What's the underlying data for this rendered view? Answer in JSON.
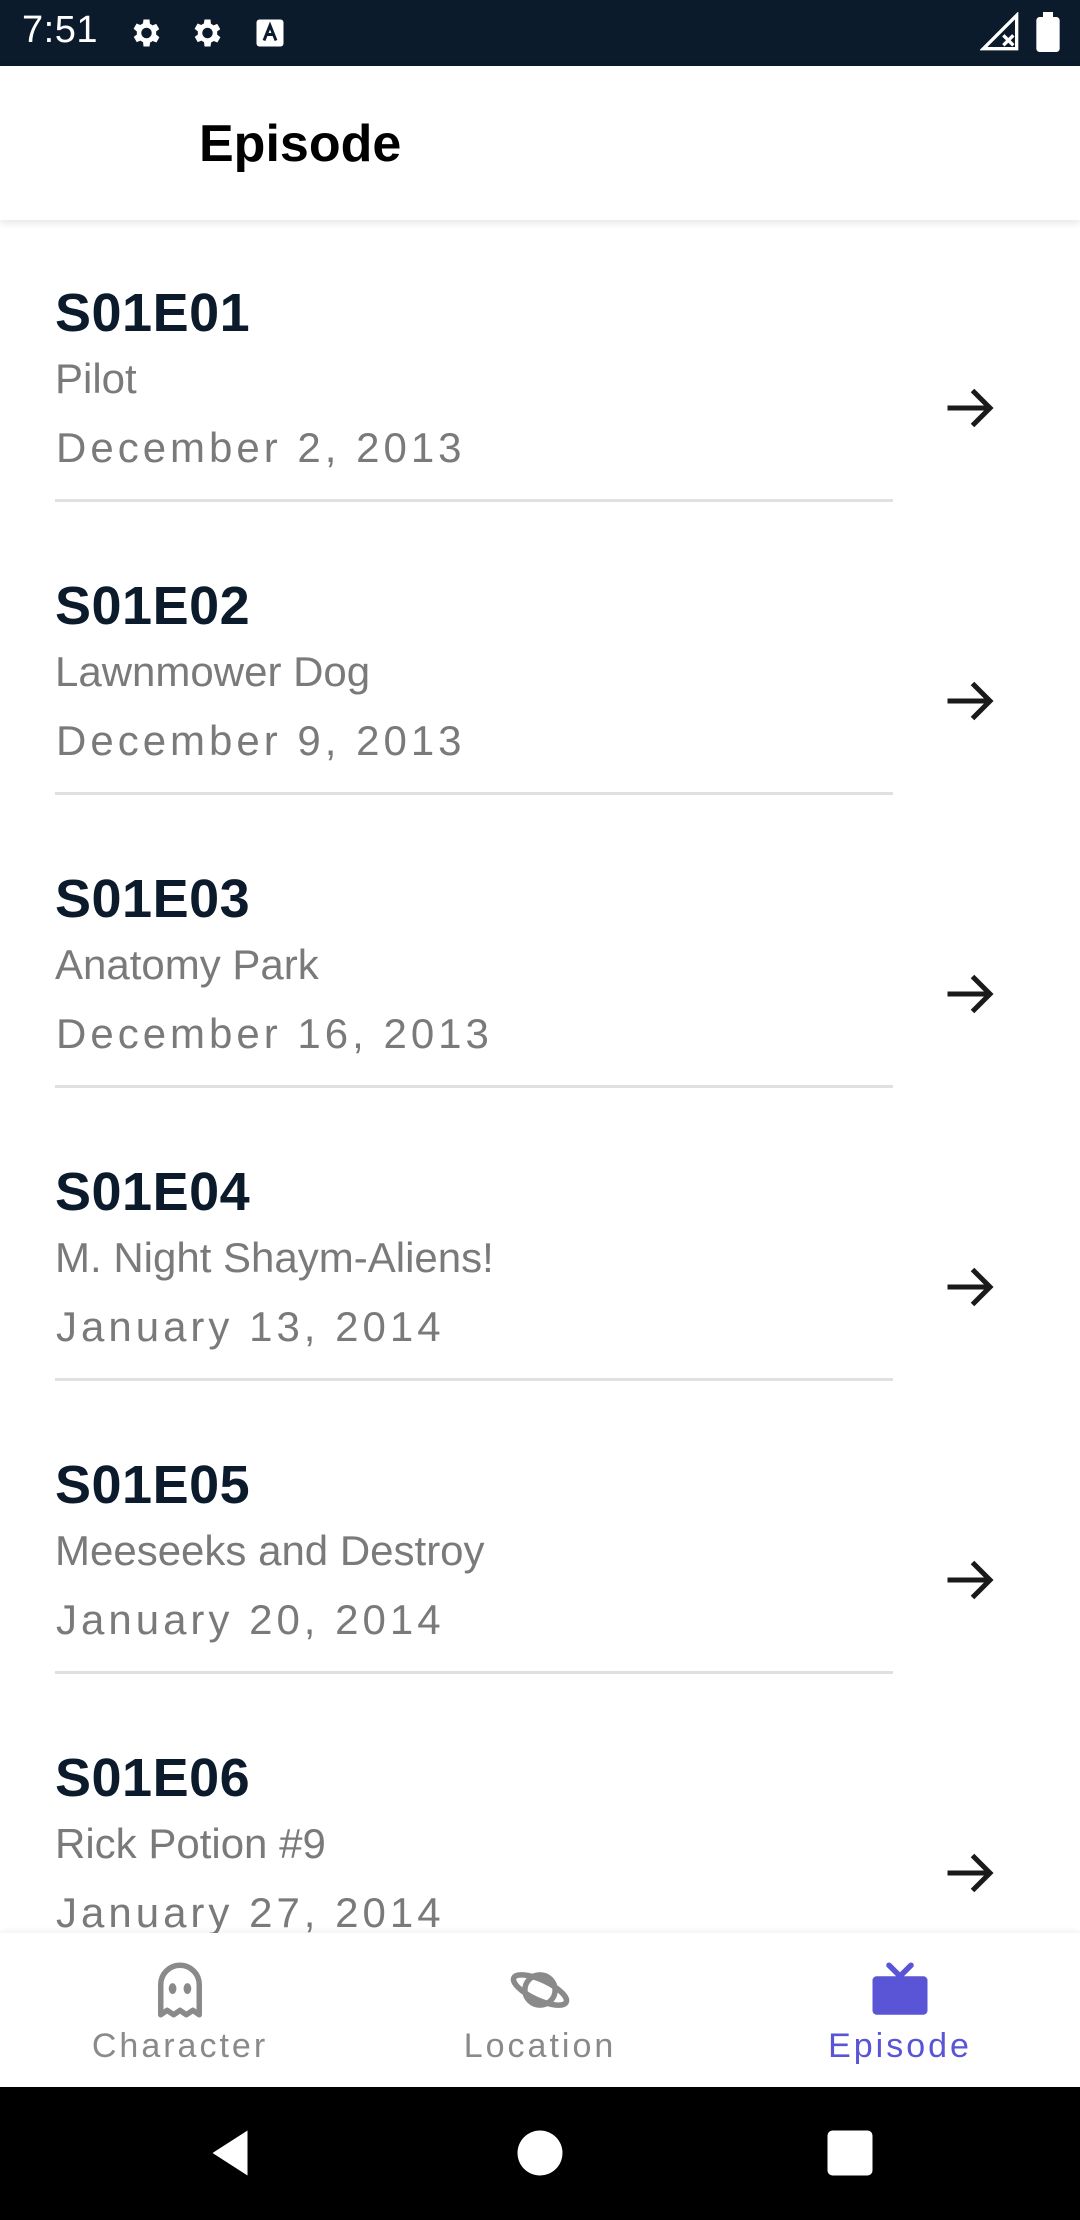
{
  "status_bar": {
    "time": "7:51",
    "icons": [
      "gear-icon",
      "gear-icon",
      "font-a-icon",
      "signal-icon",
      "battery-icon"
    ],
    "background": "#0b1b2c"
  },
  "app_bar": {
    "title": "Episode"
  },
  "episodes": [
    {
      "code": "S01E01",
      "name": "Pilot",
      "date": "December 2, 2013"
    },
    {
      "code": "S01E02",
      "name": "Lawnmower Dog",
      "date": "December 9, 2013"
    },
    {
      "code": "S01E03",
      "name": "Anatomy Park",
      "date": "December 16, 2013"
    },
    {
      "code": "S01E04",
      "name": "M. Night Shaym-Aliens!",
      "date": "January 13, 2014"
    },
    {
      "code": "S01E05",
      "name": "Meeseeks and Destroy",
      "date": "January 20, 2014"
    },
    {
      "code": "S01E06",
      "name": "Rick Potion #9",
      "date": "January 27, 2014"
    }
  ],
  "bottom_nav": {
    "items": [
      {
        "label": "Character",
        "icon": "ghost-icon",
        "active": false
      },
      {
        "label": "Location",
        "icon": "planet-icon",
        "active": false
      },
      {
        "label": "Episode",
        "icon": "tv-icon",
        "active": true
      }
    ],
    "active_color": "#5a55d6",
    "inactive_color": "#8a8a8a"
  },
  "system_nav": {
    "buttons": [
      "back-icon",
      "home-icon",
      "recents-icon"
    ]
  }
}
